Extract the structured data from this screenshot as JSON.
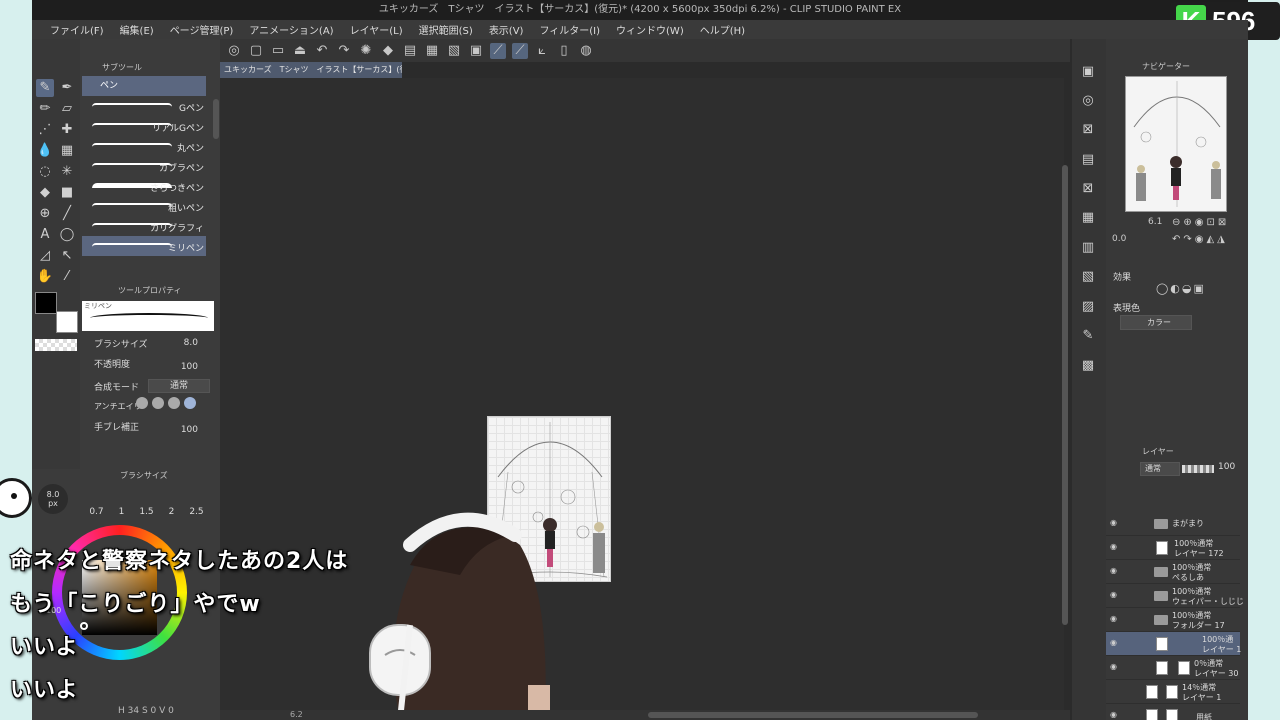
{
  "window": {
    "title": "ユキッカーズ　Tシャツ　イラスト【サーカス】(復元)* (4200 x 5600px 350dpi 6.2%)  - CLIP STUDIO PAINT EX"
  },
  "stream_badge": {
    "letter": "K",
    "count": "596"
  },
  "menu": [
    "ファイル(F)",
    "編集(E)",
    "ページ管理(P)",
    "アニメーション(A)",
    "レイヤー(L)",
    "選択範囲(S)",
    "表示(V)",
    "フィルター(I)",
    "ウィンドウ(W)",
    "ヘルプ(H)"
  ],
  "document_tab": "ユキッカーズ　Tシャツ　イラスト【サーカス】(復元)*",
  "subtool": {
    "header": "サブツール",
    "group": "ペン",
    "brushes": [
      "Gペン",
      "リアルGペン",
      "丸ペン",
      "カブラペン",
      "さらつきペン",
      "粗いペン",
      "カリグラフィ",
      "ミリペン"
    ],
    "selected": "ミリペン"
  },
  "tool_property": {
    "header": "ツールプロパティ",
    "preview_label": "ミリペン",
    "brush_size_label": "ブラシサイズ",
    "brush_size_value": "8.0",
    "opacity_label": "不透明度",
    "opacity_value": "100",
    "blend_label": "合成モード",
    "blend_value": "通常",
    "antialias_label": "アンチエイリ",
    "stabilize_label": "手ブレ補正",
    "stabilize_value": "100"
  },
  "brush_size_panel": {
    "header": "ブラシサイズ",
    "current": "8.0",
    "unit": "px",
    "presets": [
      "0.7",
      "1",
      "1.5",
      "2",
      "2.5"
    ]
  },
  "color_wheel": {
    "value_label": "100"
  },
  "status": {
    "info": "H 34  S 0  V 0",
    "zoom": "6.2"
  },
  "subtitles": [
    "命ネタと警察ネタしたあの2人は",
    "もう「こりごり」やでw",
    "いいよ",
    "いいよ"
  ],
  "navigator": {
    "header": "ナビゲーター",
    "zoom": "6.1",
    "rotation": "0.0"
  },
  "effects": {
    "header": "効果",
    "expr_color_label": "表現色",
    "expr_color_value": "カラー"
  },
  "layers": {
    "header": "レイヤー",
    "blend": "通常",
    "opacity": "100",
    "items": [
      {
        "line1": "まがまり",
        "line2": "",
        "type": "folder"
      },
      {
        "line1": "100％通常",
        "line2": "レイヤー 172",
        "type": "layer"
      },
      {
        "line1": "100％通常",
        "line2": "ぺるしあ",
        "type": "folder"
      },
      {
        "line1": "100％通常",
        "line2": "ウェイパー・しじじ",
        "type": "folder"
      },
      {
        "line1": "100％通常",
        "line2": "フォルダー 17",
        "type": "folder"
      },
      {
        "line1": "100％通",
        "line2": "レイヤー 1",
        "type": "layer",
        "selected": true
      },
      {
        "line1": "0％通常",
        "line2": "レイヤー 30",
        "type": "layer"
      },
      {
        "line1": "14％通常",
        "line2": "レイヤー 1",
        "type": "layer"
      },
      {
        "line1": "",
        "line2": "用紙",
        "type": "paper"
      }
    ]
  },
  "colors": {
    "accent": "#5b6780",
    "badge_green": "#45d64a",
    "stream_bg": "#d7f0ee"
  }
}
